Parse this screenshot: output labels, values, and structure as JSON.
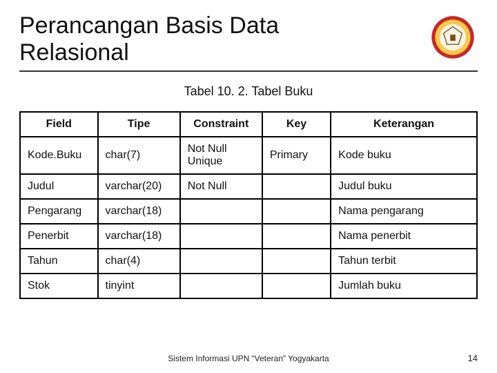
{
  "title_line1": "Perancangan Basis Data",
  "title_line2": "Relasional",
  "caption": "Tabel 10. 2. Tabel Buku",
  "columns": {
    "field": "Field",
    "tipe": "Tipe",
    "constraint": "Constraint",
    "key": "Key",
    "keterangan": "Keterangan"
  },
  "rows": [
    {
      "field": "Kode.Buku",
      "tipe": "char(7)",
      "constraint": "Not Null\nUnique",
      "key": "Primary",
      "keterangan": "Kode buku"
    },
    {
      "field": "Judul",
      "tipe": "varchar(20)",
      "constraint": "Not Null",
      "key": "",
      "keterangan": "Judul buku"
    },
    {
      "field": "Pengarang",
      "tipe": "varchar(18)",
      "constraint": "",
      "key": "",
      "keterangan": "Nama pengarang"
    },
    {
      "field": "Penerbit",
      "tipe": "varchar(18)",
      "constraint": "",
      "key": "",
      "keterangan": "Nama penerbit"
    },
    {
      "field": "Tahun",
      "tipe": "char(4)",
      "constraint": "",
      "key": "",
      "keterangan": "Tahun terbit"
    },
    {
      "field": "Stok",
      "tipe": "tinyint",
      "constraint": "",
      "key": "",
      "keterangan": "Jumlah buku"
    }
  ],
  "footer": "Sistem Informasi UPN “Veteran” Yogyakarta",
  "page_number": "14",
  "logo": {
    "outer": "#c62828",
    "ring": "#f9c946",
    "inner_bg": "#f8f4e6"
  }
}
